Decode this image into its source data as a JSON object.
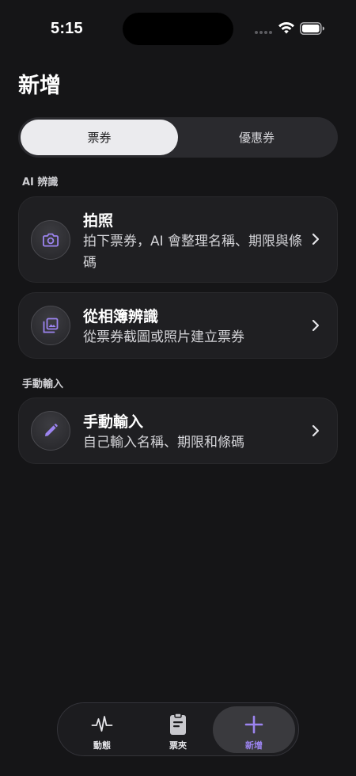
{
  "status_bar": {
    "time": "5:15"
  },
  "page": {
    "title": "新增"
  },
  "segmented": {
    "tabs": [
      "票券",
      "優惠券"
    ],
    "selected": "票券"
  },
  "sections": [
    {
      "label": "AI 辨識",
      "cards": [
        {
          "icon": "camera-icon",
          "title": "拍照",
          "subtitle": "拍下票券，AI 會整理名稱、期限與條碼"
        },
        {
          "icon": "photo-library-icon",
          "title": "從相簿辨識",
          "subtitle": "從票券截圖或照片建立票券"
        }
      ]
    },
    {
      "label": "手動輸入",
      "cards": [
        {
          "icon": "pencil-icon",
          "title": "手動輸入",
          "subtitle": "自己輸入名稱、期限和條碼"
        }
      ]
    }
  ],
  "tab_bar": {
    "items": [
      {
        "icon": "activity-icon",
        "label": "動態"
      },
      {
        "icon": "ticket-folder-icon",
        "label": "票夾"
      },
      {
        "icon": "plus-icon",
        "label": "新增"
      }
    ],
    "selected": "新增"
  },
  "colors": {
    "background": "#151517",
    "card": "#1f1f22",
    "accent": "#9c84f0"
  }
}
